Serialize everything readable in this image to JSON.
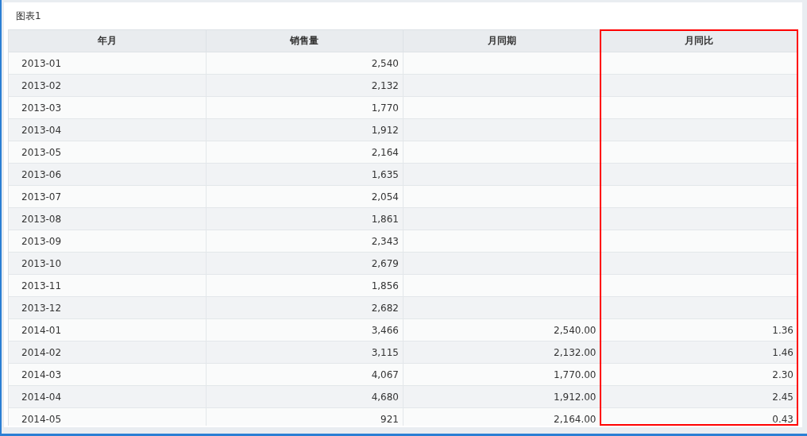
{
  "panel": {
    "title": "图表1"
  },
  "table": {
    "columns": [
      {
        "label": "年月",
        "kind": "text",
        "highlighted": false
      },
      {
        "label": "销售量",
        "kind": "number",
        "highlighted": false
      },
      {
        "label": "月同期",
        "kind": "number",
        "highlighted": false
      },
      {
        "label": "月同比",
        "kind": "number",
        "highlighted": true
      }
    ],
    "rows": [
      {
        "cells": [
          "2013-01",
          "2,540",
          null,
          null
        ]
      },
      {
        "cells": [
          "2013-02",
          "2,132",
          null,
          null
        ]
      },
      {
        "cells": [
          "2013-03",
          "1,770",
          null,
          null
        ]
      },
      {
        "cells": [
          "2013-04",
          "1,912",
          null,
          null
        ]
      },
      {
        "cells": [
          "2013-05",
          "2,164",
          null,
          null
        ]
      },
      {
        "cells": [
          "2013-06",
          "1,635",
          null,
          null
        ]
      },
      {
        "cells": [
          "2013-07",
          "2,054",
          null,
          null
        ]
      },
      {
        "cells": [
          "2013-08",
          "1,861",
          null,
          null
        ]
      },
      {
        "cells": [
          "2013-09",
          "2,343",
          null,
          null
        ]
      },
      {
        "cells": [
          "2013-10",
          "2,679",
          null,
          null
        ]
      },
      {
        "cells": [
          "2013-11",
          "1,856",
          null,
          null
        ]
      },
      {
        "cells": [
          "2013-12",
          "2,682",
          null,
          null
        ]
      },
      {
        "cells": [
          "2014-01",
          "3,466",
          "2,540.00",
          "1.36"
        ]
      },
      {
        "cells": [
          "2014-02",
          "3,115",
          "2,132.00",
          "1.46"
        ]
      },
      {
        "cells": [
          "2014-03",
          "4,067",
          "1,770.00",
          "2.30"
        ]
      },
      {
        "cells": [
          "2014-04",
          "4,680",
          "1,912.00",
          "2.45"
        ]
      },
      {
        "cells": [
          "2014-05",
          "921",
          "2,164.00",
          "0.43"
        ]
      }
    ]
  }
}
